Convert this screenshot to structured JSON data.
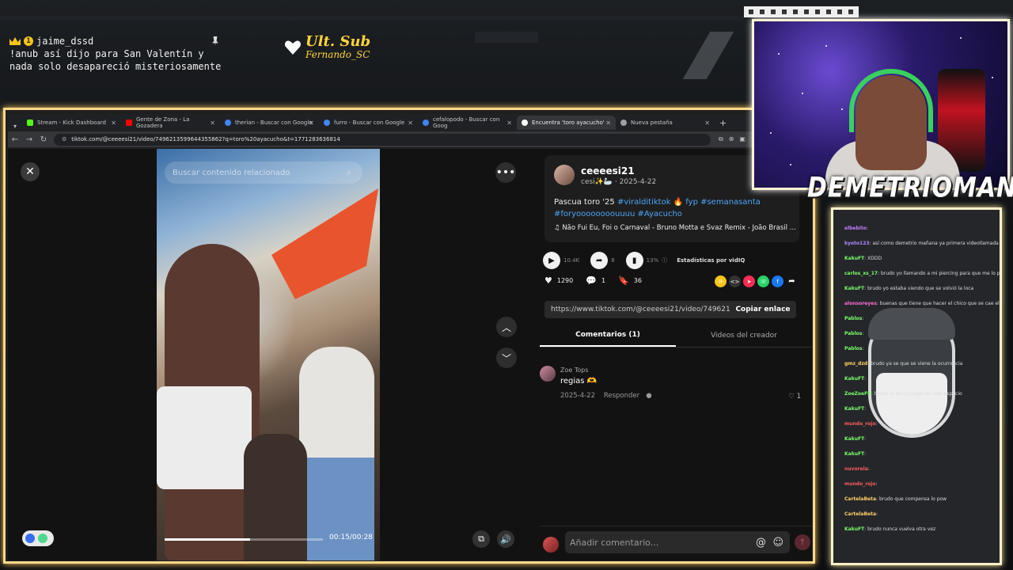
{
  "top_chat": {
    "username": "jaime_dssd",
    "badge_count": "1",
    "message_line1": "!anub así dijo para San Valentín y",
    "message_line2": "nada solo desapareció misteriosamente"
  },
  "ult_sub": {
    "title": "Ult. Sub",
    "name": "Fernando_SC"
  },
  "browser": {
    "tabs": [
      {
        "label": "Stream - Kick Dashboard",
        "color": "#53fc18"
      },
      {
        "label": "Gente de Zona - La Gozadera",
        "color": "#ff0000"
      },
      {
        "label": "therian - Buscar con Google",
        "color": "#4285f4"
      },
      {
        "label": "furro - Buscar con Google",
        "color": "#4285f4"
      },
      {
        "label": "cefalopodo - Buscar con Goog",
        "color": "#4285f4"
      },
      {
        "label": "Encuentra 'toro ayacucho'",
        "color": "#ffffff"
      },
      {
        "label": "Nueva pestaña",
        "color": "#9aa0a6"
      }
    ],
    "new_tab": "+",
    "url": "tiktok.com/@ceeeesi21/video/7496213599644355862?q=toro%20ayacucho&t=1771283636814"
  },
  "video": {
    "search_placeholder": "Buscar contenido relacionado",
    "time": "00:15/00:28",
    "progress": 0.54
  },
  "post": {
    "username": "ceeeesi21",
    "sub": "cesi✨🦢 · 2025-4-22",
    "desc_prefix": "Pascua toro '25 ",
    "tags_line1": "#viralditiktok 🔥 fyp #semanasanta",
    "tags_line2": "#foryoooooooouuuu #Ayacucho",
    "music": "♫  Não Fui Eu, Foi o Carnaval - Bruno Motta e Svaz Remix - João Brasil ...",
    "play_count": "10.4K",
    "share_count": "8",
    "stat_pct": "13%",
    "stat_label": "Estadísticas por vidIQ",
    "likes": "1290",
    "comments": "1",
    "saves": "36",
    "link": "https://www.tiktok.com/@ceeeesi21/video/749621...",
    "copy_label": "Copiar enlace",
    "tab_comments": "Comentarios (1)",
    "tab_creator": "Videos del creador"
  },
  "comment": {
    "name": "Zoe Tops",
    "text": "regias 🫶",
    "date": "2025-4-22",
    "reply": "Responder",
    "likes": "1"
  },
  "comment_input_placeholder": "Añadir comentario...",
  "streamer_name": "DEMETRIOMAN",
  "chat_panel": {
    "lines": [
      {
        "user": "elbebito",
        "msg": "",
        "color": "#c77dff"
      },
      {
        "user": "kyoto123",
        "msg": "así como demetrio mañana ya primera videollamada conversando de san valentín",
        "color": "#b388ff"
      },
      {
        "user": "KakuFT",
        "msg": "XDDD",
        "color": "#7cff6b"
      },
      {
        "user": "carlos_xs_17",
        "msg": "brudo yo llamando a mi piercing para que me lo pongan en la nariz",
        "color": "#7cff6b"
      },
      {
        "user": "KakuFT",
        "msg": "brudo yo estaba viendo que se volvió la loca",
        "color": "#7cff6b"
      },
      {
        "user": "alonsoreyes",
        "msg": "buenas que tiene que hacer el chico que se cae el pestaña",
        "color": "#ff6bd6"
      },
      {
        "user": "Pablos",
        "msg": "",
        "color": "#7cff6b"
      },
      {
        "user": "Pablos",
        "msg": "",
        "color": "#7cff6b"
      },
      {
        "user": "Pablos",
        "msg": "",
        "color": "#7cff6b"
      },
      {
        "user": "gmz_dzd",
        "msg": "brudo ya se que se viene la ocurrencia",
        "color": "#ffd166"
      },
      {
        "user": "KakuFT",
        "msg": "",
        "color": "#7cff6b"
      },
      {
        "user": "ZoeZoeFR",
        "msg": "brudo el de yo juego en este espacio",
        "color": "#7cff6b"
      },
      {
        "user": "KakuFT",
        "msg": "",
        "color": "#7cff6b"
      },
      {
        "user": "mundo_rojo",
        "msg": "",
        "color": "#ff5c5c"
      },
      {
        "user": "KakuFT",
        "msg": "",
        "color": "#7cff6b"
      },
      {
        "user": "KakuFT",
        "msg": "",
        "color": "#7cff6b"
      },
      {
        "user": "nuvorela",
        "msg": "",
        "color": "#ff5c5c"
      },
      {
        "user": "mundo_rojo",
        "msg": "",
        "color": "#ff5c5c"
      },
      {
        "user": "CartelaBeta",
        "msg": "brudo que compensa lo pow",
        "color": "#ffd166"
      },
      {
        "user": "CartelaBeta",
        "msg": "",
        "color": "#ffd166"
      },
      {
        "user": "KakuFT",
        "msg": "brudo nunca vuelva otra vez",
        "color": "#7cff6b"
      }
    ]
  }
}
